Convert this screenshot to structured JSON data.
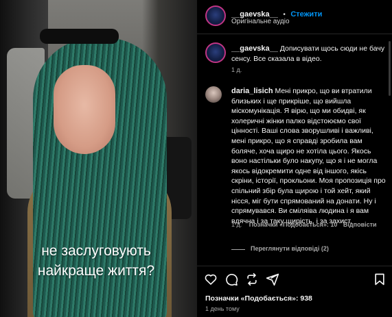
{
  "post": {
    "author": "__gaevska__",
    "separator": "•",
    "follow_label": "Стежити",
    "audio": "Оригінальне аудіо",
    "caption_overlay_line1": "не заслуговують",
    "caption_overlay_line2": "найкраще життя?"
  },
  "author_comment": {
    "username": "__gaevska__",
    "text": "Дописувати щось сюди не бачу сенсу. Все сказала в відео.",
    "age": "1 д."
  },
  "comment": {
    "username": "daria_lisich",
    "text": "Мені прикро, що ви втратили близьких і ще прикріше, що вийшла міскомунікація. Я вірю, що ми обидві, як холеричні жінки палко відстоюємо свої цінності. Ваші слова зворушливі і важливі, мені прикро, що я справді зробила вам боляче, хоча щиро не хотіла цього. Якось воно настільки було накупу, що я і не могла якось відокремити одне від іншого, якісь скріни, історії, прокльони. Моя пропозиція про спільний збір була щирою і той хейт, який нісся, міг бути спрямований на донати. Ну і спрямувався. Ви сміляіва людина і я вам вдячна і за таку щирість, і за захист.",
    "age": "1 д.",
    "likes": "Позначки «Подобається»: 10",
    "reply": "Відповісти",
    "view_replies": "Переглянути відповіді (2)"
  },
  "footer": {
    "likes": "Позначки «Подобається»: 938",
    "date": "1 день тому"
  },
  "colors": {
    "accent": "#0095f6",
    "background": "#000000",
    "muted": "#a8a8a8"
  },
  "icons": [
    "heart-icon",
    "comment-icon",
    "repost-icon",
    "share-icon",
    "bookmark-icon",
    "volume-icon"
  ]
}
